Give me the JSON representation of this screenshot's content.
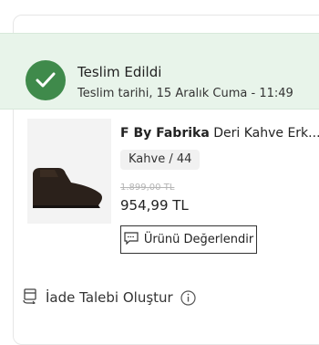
{
  "delivery": {
    "status_title": "Teslim Edildi",
    "status_date": "Teslim tarihi, 15 Aralık Cuma - 11:49"
  },
  "product": {
    "brand": "F By Fabrika",
    "name": "Deri Kahve Erk...",
    "variant": "Kahve / 44",
    "old_price": "1.899,00 TL",
    "price": "954,99 TL"
  },
  "actions": {
    "review_label": "Ürünü Değerlendir",
    "return_label": "İade Talebi Oluştur"
  },
  "colors": {
    "status_bg": "#e8f4ea",
    "check_green": "#3f8a4b"
  },
  "icons": {
    "status": "check-icon",
    "review": "comment-icon",
    "return": "return-package-icon",
    "info": "info-icon"
  }
}
